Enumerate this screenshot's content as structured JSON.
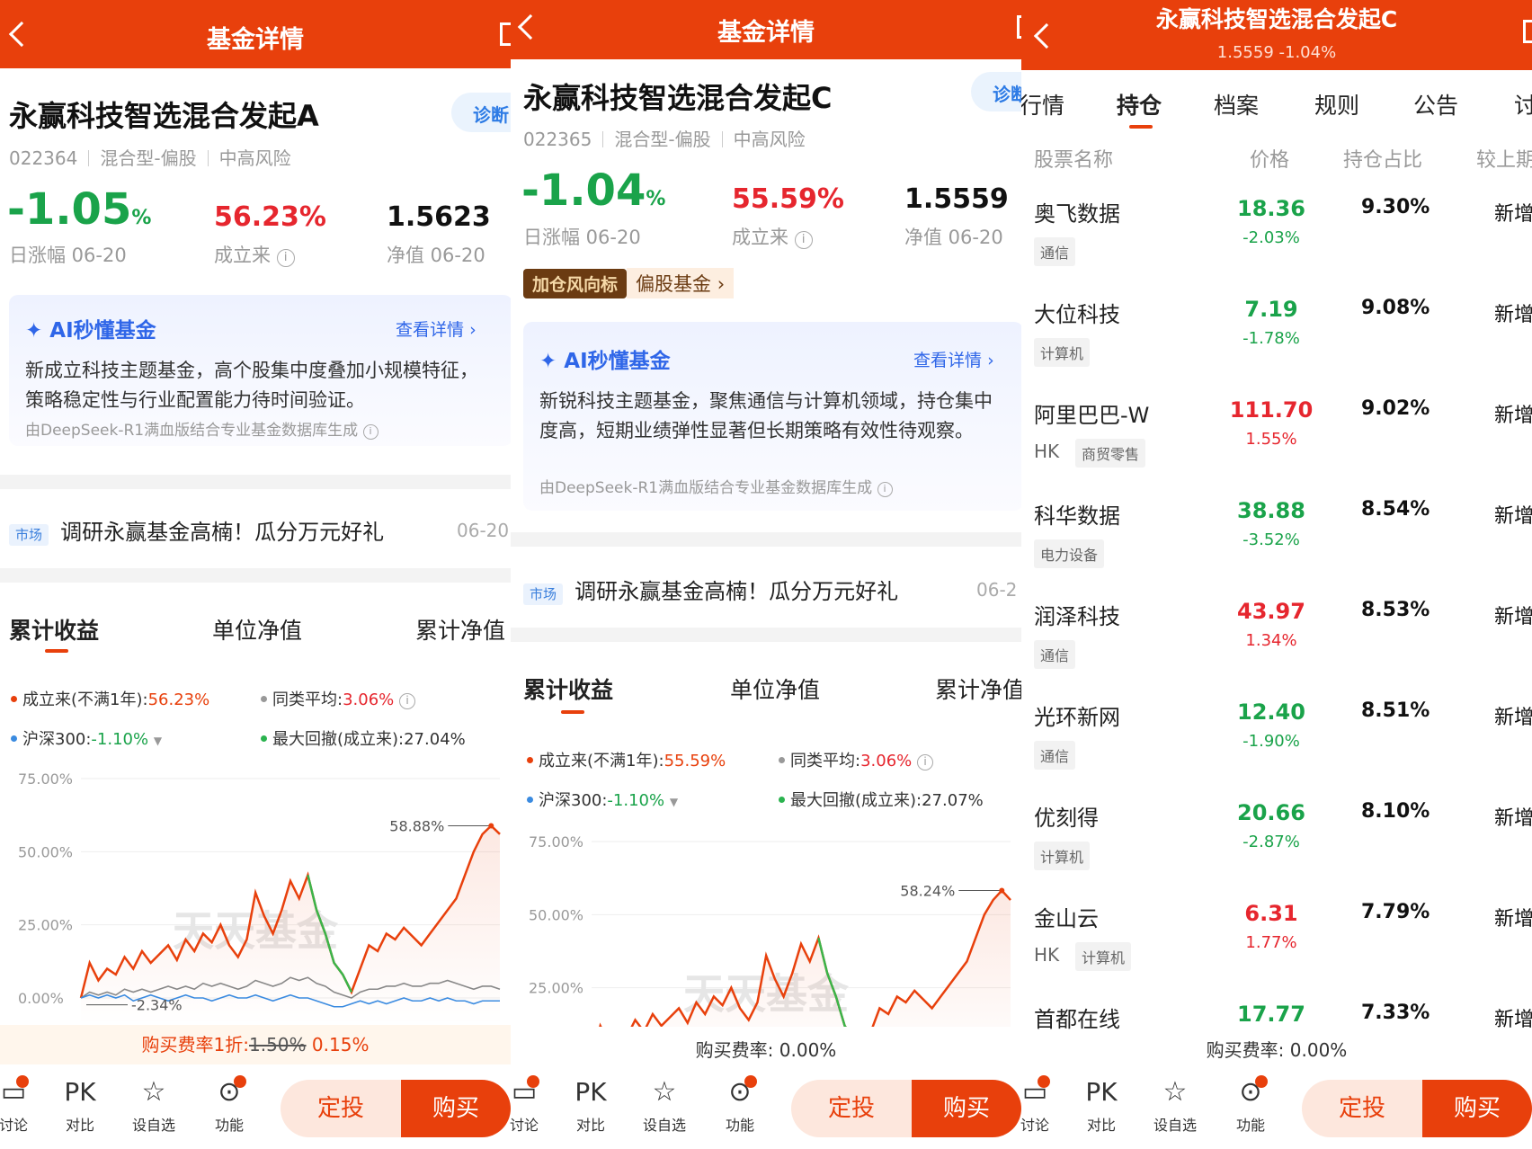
{
  "colors": {
    "brand": "#e8400c",
    "up": "#e6262e",
    "down": "#1aa34a",
    "link": "#2f66e8"
  },
  "panel_a": {
    "header_title": "基金详情",
    "fund_name": "永赢科技智选混合发起A",
    "diagnose_label": "诊断",
    "code": "022364",
    "type": "混合型-偏股",
    "risk": "中高风险",
    "daily_change": "-1.05",
    "daily_change_unit": "%",
    "daily_change_label": "日涨幅 06-20",
    "since_inception": "56.23%",
    "since_inception_label": "成立来",
    "nav": "1.5623",
    "nav_label": "净值 06-20",
    "ai_title": "AI秒懂基金",
    "ai_link": "查看详情",
    "ai_body": "新成立科技主题基金，高个股集中度叠加小规模特征，策略稳定性与行业配置能力待时间验证。",
    "ai_source": "由DeepSeek-R1满血版结合专业基金数据库生成",
    "market_tag": "市场",
    "market_text": "调研永赢基金高楠！瓜分万元好礼",
    "market_date": "06-20",
    "tabs": [
      "累计收益",
      "单位净值",
      "累计净值"
    ],
    "legend": {
      "l1_label": "成立来(不满1年):",
      "l1_value": "56.23%",
      "l2_label": "同类平均:",
      "l2_value": "3.06%",
      "l3_label": "沪深300:",
      "l3_value": "-1.10%",
      "l4_label": "最大回撤(成立来):",
      "l4_value": "27.04%"
    },
    "fee_prefix": "购买费率1折:",
    "fee_old": "1.50%",
    "fee_new": "0.15%"
  },
  "panel_b": {
    "header_title": "基金详情",
    "fund_name": "永赢科技智选混合发起C",
    "diagnose_label": "诊断",
    "code": "022365",
    "type": "混合型-偏股",
    "risk": "中高风险",
    "daily_change": "-1.04",
    "daily_change_unit": "%",
    "daily_change_label": "日涨幅 06-20",
    "since_inception": "55.59%",
    "since_inception_label": "成立来",
    "nav": "1.5559",
    "nav_label": "净值 06-20",
    "tag_dark": "加仓风向标",
    "tag_light": "偏股基金",
    "ai_title": "AI秒懂基金",
    "ai_link": "查看详情",
    "ai_body": "新锐科技主题基金，聚焦通信与计算机领域，持仓集中度高，短期业绩弹性显著但长期策略有效性待观察。",
    "ai_source": "由DeepSeek-R1满血版结合专业基金数据库生成",
    "market_tag": "市场",
    "market_text": "调研永赢基金高楠！瓜分万元好礼",
    "market_date": "06-2",
    "tabs": [
      "累计收益",
      "单位净值",
      "累计净值"
    ],
    "legend": {
      "l1_label": "成立来(不满1年):",
      "l1_value": "55.59%",
      "l2_label": "同类平均:",
      "l2_value": "3.06%",
      "l3_label": "沪深300:",
      "l3_value": "-1.10%",
      "l4_label": "最大回撤(成立来):",
      "l4_value": "27.07%"
    },
    "fee_text": "购买费率: 0.00%"
  },
  "panel_c": {
    "header_title": "永赢科技智选混合发起C",
    "header_sub": "1.5559 -1.04%",
    "tabs": [
      "行情",
      "持仓",
      "档案",
      "规则",
      "公告",
      "讨"
    ],
    "cols": [
      "股票名称",
      "价格",
      "持仓占比",
      "较上期"
    ],
    "holdings": [
      {
        "name": "奥飞数据",
        "hk": "",
        "tag": "通信",
        "price": "18.36",
        "change": "-2.03%",
        "dir": "down",
        "weight": "9.30%",
        "vs": "新增"
      },
      {
        "name": "大位科技",
        "hk": "",
        "tag": "计算机",
        "price": "7.19",
        "change": "-1.78%",
        "dir": "down",
        "weight": "9.08%",
        "vs": "新增"
      },
      {
        "name": "阿里巴巴-W",
        "hk": "HK",
        "tag": "商贸零售",
        "price": "111.70",
        "change": "1.55%",
        "dir": "up",
        "weight": "9.02%",
        "vs": "新增"
      },
      {
        "name": "科华数据",
        "hk": "",
        "tag": "电力设备",
        "price": "38.88",
        "change": "-3.52%",
        "dir": "down",
        "weight": "8.54%",
        "vs": "新增"
      },
      {
        "name": "润泽科技",
        "hk": "",
        "tag": "通信",
        "price": "43.97",
        "change": "1.34%",
        "dir": "up",
        "weight": "8.53%",
        "vs": "新增"
      },
      {
        "name": "光环新网",
        "hk": "",
        "tag": "通信",
        "price": "12.40",
        "change": "-1.90%",
        "dir": "down",
        "weight": "8.51%",
        "vs": "新增"
      },
      {
        "name": "优刻得",
        "hk": "",
        "tag": "计算机",
        "price": "20.66",
        "change": "-2.87%",
        "dir": "down",
        "weight": "8.10%",
        "vs": "新增"
      },
      {
        "name": "金山云",
        "hk": "HK",
        "tag": "计算机",
        "price": "6.31",
        "change": "1.77%",
        "dir": "up",
        "weight": "7.79%",
        "vs": "新增"
      },
      {
        "name": "首都在线",
        "hk": "",
        "tag": "",
        "price": "17.77",
        "change": "",
        "dir": "down",
        "weight": "7.33%",
        "vs": "新增"
      }
    ],
    "fee_text": "购买费率: 0.00%"
  },
  "bottom_bar": {
    "discuss": "讨论",
    "pk_glyph": "PK",
    "compare": "对比",
    "watch": "设自选",
    "func": "功能",
    "sip": "定投",
    "buy": "购买"
  },
  "chart_data": [
    {
      "type": "line",
      "yticks": [
        "75.00%",
        "50.00%",
        "25.00%",
        "0.00%"
      ],
      "ylim": [
        -5,
        80
      ],
      "series": [
        {
          "name": "成立来",
          "color": "#e8400c",
          "values": [
            0,
            12,
            6,
            10,
            8,
            14,
            10,
            16,
            12,
            15,
            18,
            13,
            20,
            16,
            22,
            19,
            25,
            18,
            14,
            20,
            36,
            28,
            22,
            30,
            40,
            34,
            42,
            30,
            22,
            12,
            8,
            2,
            10,
            18,
            16,
            22,
            20,
            24,
            21,
            18,
            22,
            26,
            30,
            34,
            42,
            50,
            56,
            58.88,
            56
          ]
        },
        {
          "name": "同类平均",
          "color": "#888888",
          "values": [
            0,
            2,
            1,
            2,
            1,
            3,
            2,
            3,
            2,
            3,
            4,
            3,
            4,
            3,
            5,
            4,
            5,
            4,
            3,
            4,
            6,
            5,
            4,
            5,
            7,
            6,
            7,
            5,
            4,
            2,
            1,
            0,
            2,
            3,
            3,
            4,
            4,
            5,
            4,
            4,
            5,
            5,
            6,
            5,
            4,
            3,
            4,
            4,
            3
          ]
        },
        {
          "name": "沪深300",
          "color": "#3b8be0",
          "values": [
            0,
            1,
            0,
            1,
            0,
            1,
            -1,
            0,
            1,
            0,
            -1,
            0,
            1,
            0,
            0,
            -1,
            0,
            1,
            0,
            0,
            1,
            0,
            -1,
            0,
            1,
            0,
            0,
            -1,
            -2,
            -3,
            -3,
            -2,
            -1,
            -2,
            -1,
            -2,
            -1,
            0,
            -1,
            -1,
            0,
            -1,
            0,
            -1,
            -1,
            -2,
            -1,
            -1,
            -1
          ]
        }
      ],
      "annotations": [
        "58.88%",
        "-2.34%"
      ],
      "watermark": "天天基金"
    },
    {
      "type": "line",
      "yticks": [
        "75.00%",
        "50.00%",
        "25.00%"
      ],
      "ylim": [
        -5,
        80
      ],
      "series": [
        {
          "name": "成立来",
          "color": "#e8400c",
          "values": [
            0,
            12,
            6,
            10,
            8,
            14,
            10,
            16,
            12,
            15,
            18,
            13,
            20,
            16,
            22,
            19,
            25,
            18,
            14,
            20,
            36,
            28,
            22,
            30,
            40,
            34,
            42,
            30,
            22,
            12,
            8,
            2,
            10,
            18,
            16,
            22,
            20,
            24,
            21,
            18,
            22,
            26,
            30,
            34,
            42,
            50,
            55,
            58.24,
            55
          ]
        }
      ],
      "annotations": [
        "58.24%"
      ],
      "watermark": "天天基金"
    }
  ]
}
